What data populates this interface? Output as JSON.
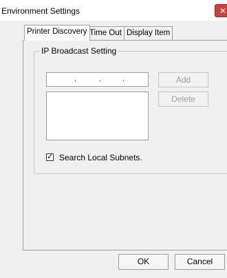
{
  "window": {
    "title": "Environment Settings",
    "close_glyph": "✕"
  },
  "tabs": [
    {
      "label": "Printer Discovery",
      "active": true
    },
    {
      "label": "Time Out",
      "active": false
    },
    {
      "label": "Display Item",
      "active": false
    }
  ],
  "ip_broadcast": {
    "group_label": "IP Broadcast Setting",
    "ip_value": ". . .",
    "add_label": "Add",
    "delete_label": "Delete",
    "list_items": []
  },
  "search_local_subnets": {
    "label": "Search Local Subnets.",
    "checked": true,
    "check_glyph": "✓"
  },
  "footer": {
    "ok_label": "OK",
    "cancel_label": "Cancel"
  },
  "colors": {
    "window_bg": "#f0f0f0",
    "close_button": "#c7443c"
  }
}
